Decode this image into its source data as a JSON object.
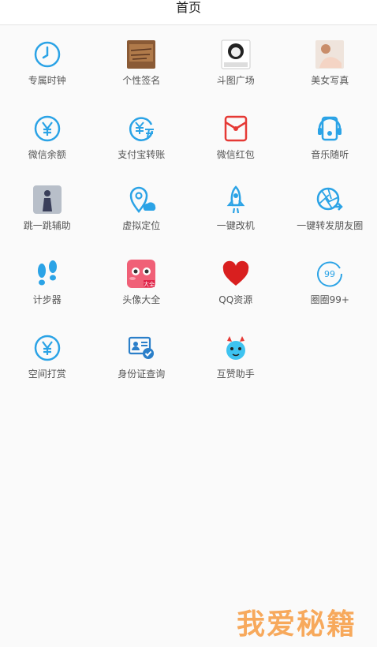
{
  "header": {
    "title": "首页"
  },
  "tiles": [
    {
      "label": "专属时钟",
      "icon": "clock-icon"
    },
    {
      "label": "个性签名",
      "icon": "signature-photo-icon"
    },
    {
      "label": "斗图广场",
      "icon": "meme-face-icon"
    },
    {
      "label": "美女写真",
      "icon": "portrait-photo-icon"
    },
    {
      "label": "微信余额",
      "icon": "yuan-circle-icon"
    },
    {
      "label": "支付宝转账",
      "icon": "alipay-transfer-icon"
    },
    {
      "label": "微信红包",
      "icon": "red-envelope-icon"
    },
    {
      "label": "音乐随听",
      "icon": "music-player-icon"
    },
    {
      "label": "跳一跳辅助",
      "icon": "jump-game-icon"
    },
    {
      "label": "虚拟定位",
      "icon": "location-pin-icon"
    },
    {
      "label": "一键改机",
      "icon": "rocket-icon"
    },
    {
      "label": "一键转发朋友圈",
      "icon": "moments-share-icon"
    },
    {
      "label": "计步器",
      "icon": "footprints-icon"
    },
    {
      "label": "头像大全",
      "icon": "avatar-collection-icon"
    },
    {
      "label": "QQ资源",
      "icon": "heart-icon"
    },
    {
      "label": "圈圈99+",
      "icon": "circle-99-icon"
    },
    {
      "label": "空间打赏",
      "icon": "yuan-tip-icon"
    },
    {
      "label": "身份证查询",
      "icon": "id-card-icon"
    },
    {
      "label": "互赞助手",
      "icon": "devil-face-icon"
    }
  ],
  "badges": {
    "circle99": "99",
    "avatar_tag": "大全",
    "meme_caption": "多少爹里来我自己"
  },
  "watermark": {
    "text": "我爱秘籍"
  },
  "colors": {
    "accent": "#2ba3e6",
    "red": "#e53935",
    "pink": "#f06077",
    "watermark": "#f7a95c"
  }
}
